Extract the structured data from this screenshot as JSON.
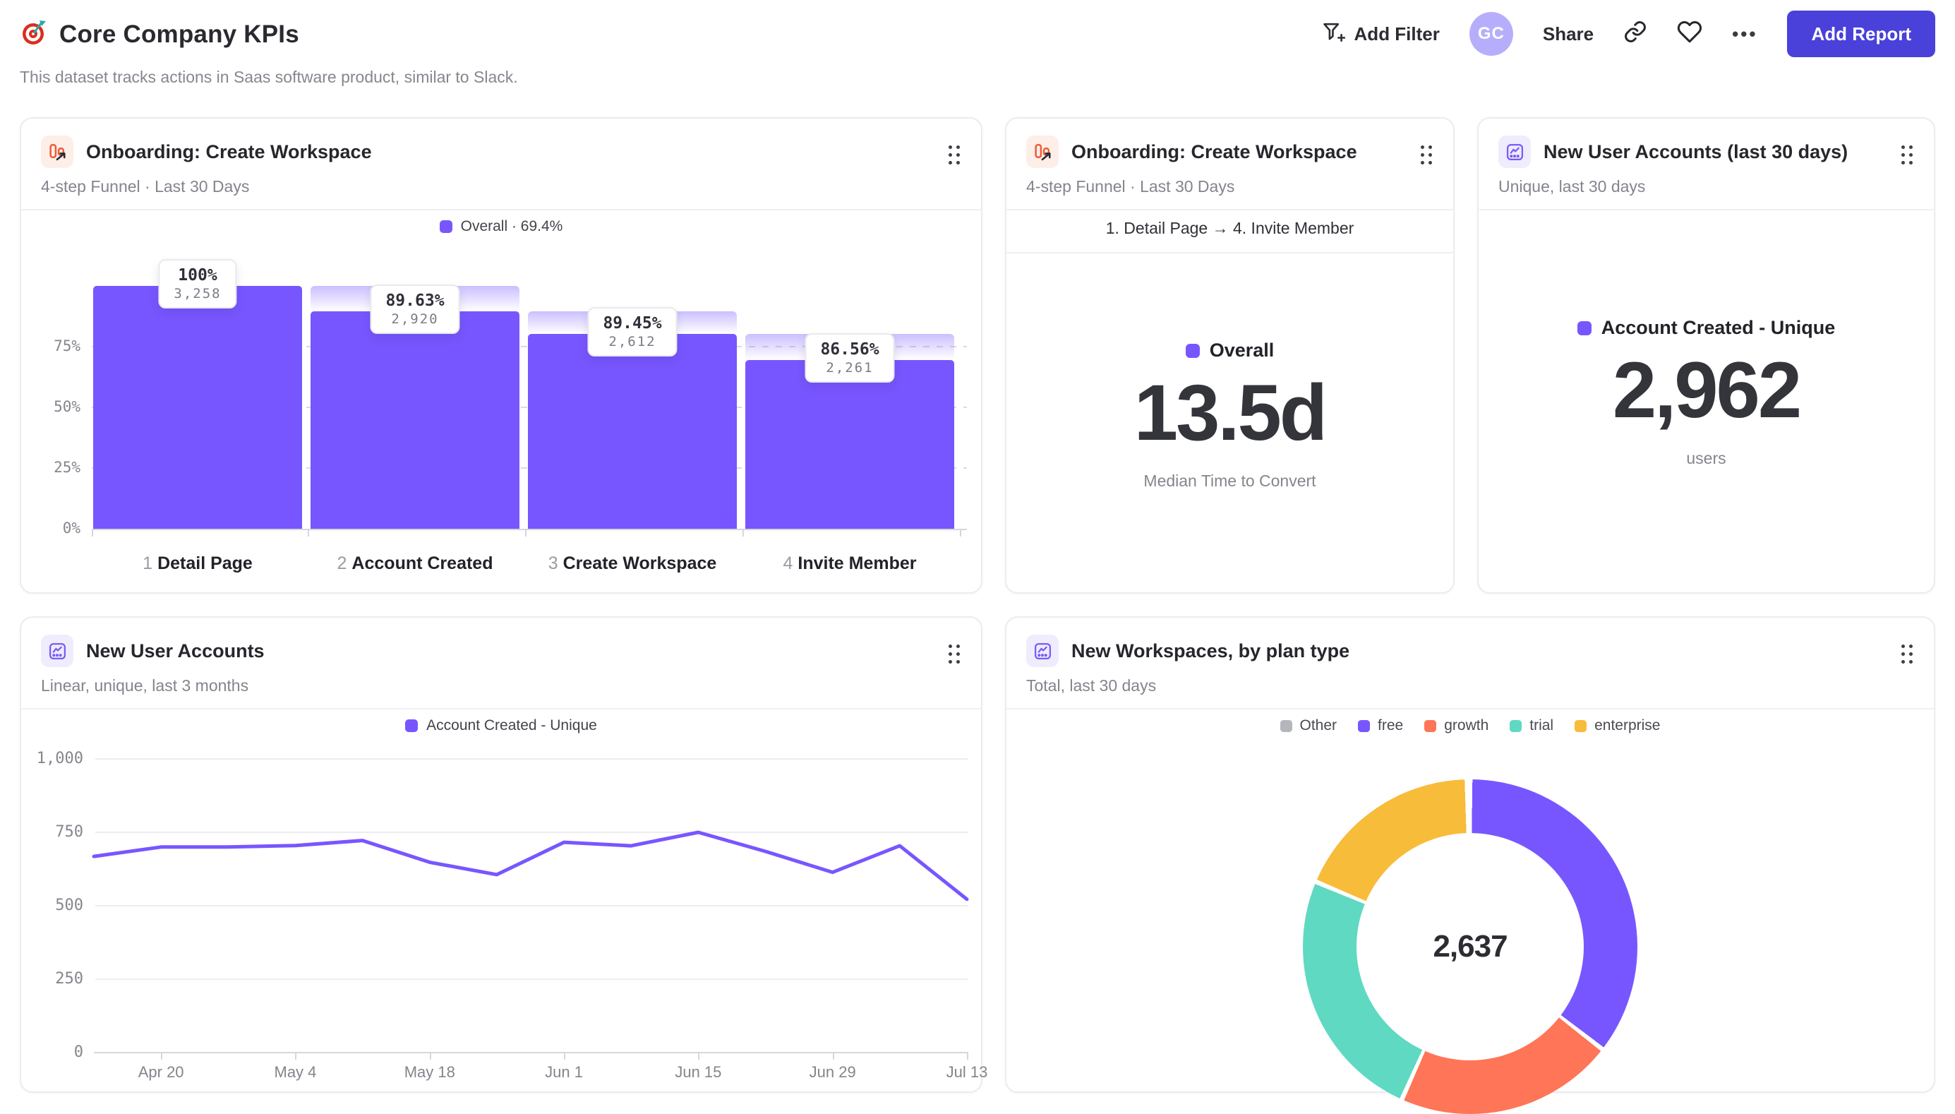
{
  "header": {
    "title": "Core Company KPIs",
    "subtitle": "This dataset tracks actions in Saas software product, similar to Slack.",
    "toolbar": {
      "add_filter": "Add Filter",
      "avatar": "GC",
      "share": "Share",
      "more": "•••",
      "add_report": "Add Report"
    }
  },
  "colors": {
    "purple": "#7856FF",
    "coral": "#FF7557",
    "teal": "#5FD9C2",
    "yellow": "#F8BC3B",
    "gray": "#B5B5BC",
    "button_indigo": "#4A40DA"
  },
  "cards": {
    "funnel": {
      "title": "Onboarding: Create Workspace",
      "subtitle": "4-step Funnel · Last 30 Days",
      "legend": "Overall · 69.4%"
    },
    "funnel_metric": {
      "title": "Onboarding: Create Workspace",
      "subtitle": "4-step Funnel · Last 30 Days",
      "range": "1. Detail Page → 4. Invite Member",
      "legend": "Overall",
      "value": "13.5d",
      "caption": "Median Time to Convert"
    },
    "accounts_metric": {
      "title": "New User Accounts (last 30 days)",
      "subtitle": "Unique, last 30 days",
      "legend": "Account Created - Unique",
      "value": "2,962",
      "caption": "users"
    },
    "accounts_line": {
      "title": "New User Accounts",
      "subtitle": "Linear, unique, last 3 months",
      "legend": "Account Created - Unique"
    },
    "workspaces_donut": {
      "title": "New Workspaces, by plan type",
      "subtitle": "Total, last 30 days",
      "center_value": "2,637"
    }
  },
  "chart_data": [
    {
      "id": "onboarding-funnel",
      "type": "bar",
      "title": "Onboarding: Create Workspace",
      "legend": "Overall · 69.4%",
      "step_numbers": [
        1,
        2,
        3,
        4
      ],
      "step_labels": [
        "Detail Page",
        "Account Created",
        "Create Workspace",
        "Invite Member"
      ],
      "counts": [
        3258,
        2920,
        2612,
        2261
      ],
      "count_labels": [
        "3,258",
        "2,920",
        "2,612",
        "2,261"
      ],
      "conversion_labels": [
        "100%",
        "89.63%",
        "89.45%",
        "86.56%"
      ],
      "overall_conversion": "69.4%",
      "yticks": [
        "75%",
        "50%",
        "25%",
        "0%"
      ],
      "ylim": [
        0,
        100
      ],
      "bar_color": "#7856FF"
    },
    {
      "id": "new-user-accounts-weekly",
      "type": "line",
      "series": [
        {
          "name": "Account Created - Unique",
          "values": [
            668,
            700,
            700,
            705,
            722,
            648,
            606,
            716,
            704,
            750,
            685,
            614,
            704,
            522
          ]
        }
      ],
      "x_tick_labels": [
        "Apr 20",
        "May 4",
        "May 18",
        "Jun 1",
        "Jun 15",
        "Jun 29",
        "Jul 13"
      ],
      "x_tick_indices": [
        1,
        3,
        5,
        7,
        9,
        11,
        13
      ],
      "yticks": [
        "1,000",
        "750",
        "500",
        "250",
        "0"
      ],
      "ylim": [
        0,
        1000
      ],
      "line_color": "#7856FF"
    },
    {
      "id": "new-workspaces-by-plan",
      "type": "pie",
      "total": 2637,
      "total_label": "2,637",
      "legend_position": "top",
      "segments": [
        {
          "label": "Other",
          "value": 8,
          "color": "#B5B5BC"
        },
        {
          "label": "free",
          "value": 936,
          "color": "#7856FF"
        },
        {
          "label": "growth",
          "value": 559,
          "color": "#FF7557"
        },
        {
          "label": "trial",
          "value": 650,
          "color": "#5FD9C2"
        },
        {
          "label": "enterprise",
          "value": 484,
          "color": "#F8BC3B"
        }
      ]
    }
  ]
}
